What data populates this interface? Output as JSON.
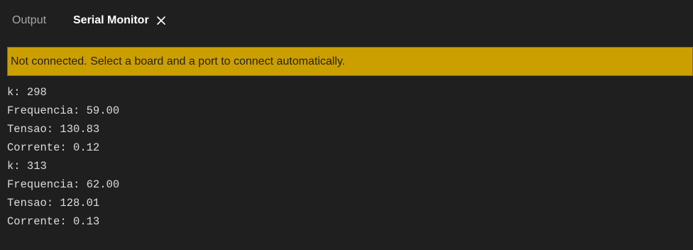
{
  "tabs": {
    "output_label": "Output",
    "serial_monitor_label": "Serial Monitor",
    "active": "Serial Monitor"
  },
  "banner": {
    "message": "Not connected. Select a board and a port to connect automatically.",
    "color": "#cc9f00"
  },
  "console": {
    "lines": [
      "k: 298",
      "Frequencia: 59.00",
      "Tensao: 130.83",
      "Corrente: 0.12",
      "k: 313",
      "Frequencia: 62.00",
      "Tensao: 128.01",
      "Corrente: 0.13"
    ]
  },
  "icons": {
    "close": "close-icon"
  }
}
